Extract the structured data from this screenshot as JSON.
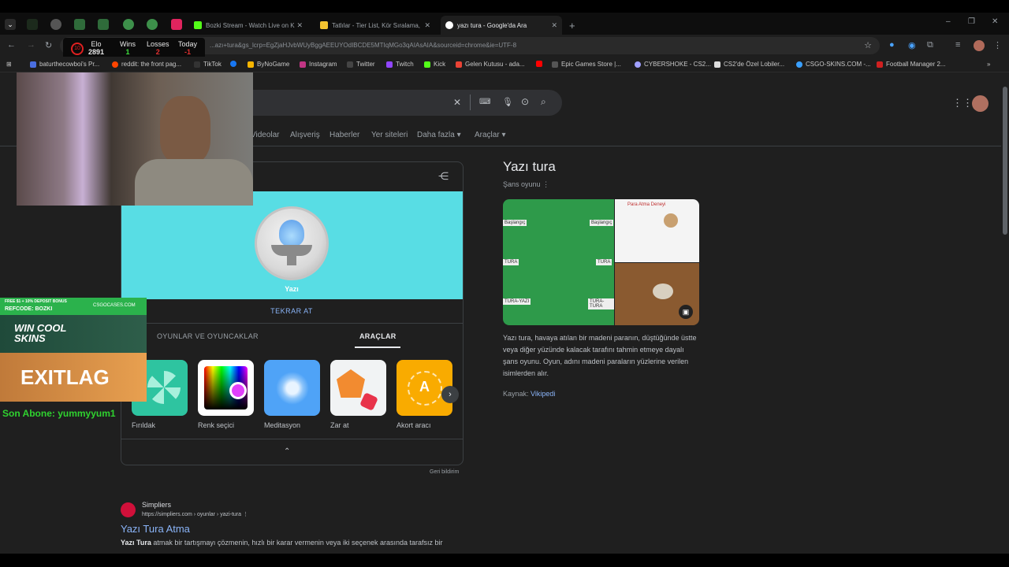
{
  "tabs": [
    {
      "label": "Bozki Stream - Watch Live on K",
      "favicon_color": "#53fc18"
    },
    {
      "label": "Tatlılar - Tier List, Kör Sıralama,",
      "favicon_color": "#f4c430"
    },
    {
      "label": "yazı tura - Google'da Ara",
      "favicon_color": "#4285f4",
      "active": true
    }
  ],
  "new_tab": "+",
  "window_controls": {
    "minimize": "–",
    "maximize": "❐",
    "close": "✕"
  },
  "address_bar": {
    "url": "...azı+tura&gs_lcrp=EgZjaHJvbWUyBggAEEUYOdIBCDE5MTIqMGo3qAIAsAIA&sourceid=chrome&ie=UTF-8"
  },
  "bookmarks": [
    {
      "label": "baturthecowboi's Pr...",
      "color": "#4a6ee0"
    },
    {
      "label": "reddit: the front pag...",
      "color": "#ff4500"
    },
    {
      "label": "TikTok",
      "color": "#111111"
    },
    {
      "label": "",
      "color": "#1877f2"
    },
    {
      "label": "ByNoGame",
      "color": "#f7b500"
    },
    {
      "label": "Instagram",
      "color": "#c13584"
    },
    {
      "label": "Twitter",
      "color": "#cccccc"
    },
    {
      "label": "Twitch",
      "color": "#9146ff"
    },
    {
      "label": "Kick",
      "color": "#53fc18"
    },
    {
      "label": "Gelen Kutusu - ada...",
      "color": "#ea4335"
    },
    {
      "label": "",
      "color": "#ff0000"
    },
    {
      "label": "Epic Games Store |...",
      "color": "#2a2a2a"
    },
    {
      "label": "CYBERSHOKE - CS2...",
      "color": "#a0a0ff"
    },
    {
      "label": "CS2'de Özel Lobiler...",
      "color": "#dddddd"
    },
    {
      "label": "CSGO-SKINS.COM -...",
      "color": "#3aa0ff"
    },
    {
      "label": "Football Manager 2...",
      "color": "#d02020"
    }
  ],
  "elo_widget": {
    "level": "10",
    "elo_label": "Elo",
    "elo_value": "2891",
    "wins_label": "Wins",
    "wins_value": "1",
    "losses_label": "Losses",
    "losses_value": "2",
    "today_label": "Today",
    "today_value": "-1"
  },
  "google": {
    "tabs": [
      "Videolar",
      "Alışveriş",
      "Haberler",
      "Yer siteleri",
      "Daha fazla ▾",
      "Araçlar ▾"
    ],
    "coin_label": "Yazı",
    "retry_label": "TEKRAR AT",
    "subtabs": [
      "OYUNLAR VE OYUNCAKLAR",
      "ARAÇLAR"
    ],
    "tools": [
      {
        "label": "Fırıldak",
        "color": "#2ec4a0"
      },
      {
        "label": "Renk seçici",
        "color": "#ffffff"
      },
      {
        "label": "Meditasyon",
        "color": "#4fa3f7"
      },
      {
        "label": "Zar at",
        "color": "#f1f3f4"
      },
      {
        "label": "Akort aracı",
        "color": "#f9ab00"
      }
    ],
    "tuner_letter": "A",
    "feedback": "Geri bildirim",
    "knowledge_panel": {
      "title": "Yazı tura",
      "subtitle": "Şans oyunu",
      "image_texts": [
        "Başlangıç",
        "Başlangıç",
        "TURA",
        "TURA",
        "TURA-YAZI",
        "TURA-TURA",
        "Para Atma Deneyi"
      ],
      "description": "Yazı tura, havaya atılan bir madeni paranın, düştüğünde üstte veya diğer yüzünde kalacak tarafını tahmin etmeye dayalı şans oyunu. Oyun, adını madeni paraların yüzlerine verilen isimlerden alır.",
      "source_label": "Kaynak:",
      "source_link": "Vikipedi"
    },
    "result": {
      "site": "Simpliers",
      "url": "https://simpliers.com › oyunlar › yazi-tura",
      "title": "Yazı Tura Atma",
      "snippet_bold": "Yazı Tura",
      "snippet": " atmak bir tartışmayı çözmenin, hızlı bir karar vermenin veya iki seçenek arasında tarafsız bir"
    }
  },
  "overlay": {
    "sponsor_top": "FREE $1 + 10% DEPOSIT BONUS",
    "sponsor_code": "REFCODE: BOZKI",
    "sponsor_brand": "CSGOCASES.COM",
    "sponsor_slogan": "WIN COOL SKINS",
    "exitlag": "EXITLAG",
    "last_sub": "Son Abone: yummyyum1"
  }
}
